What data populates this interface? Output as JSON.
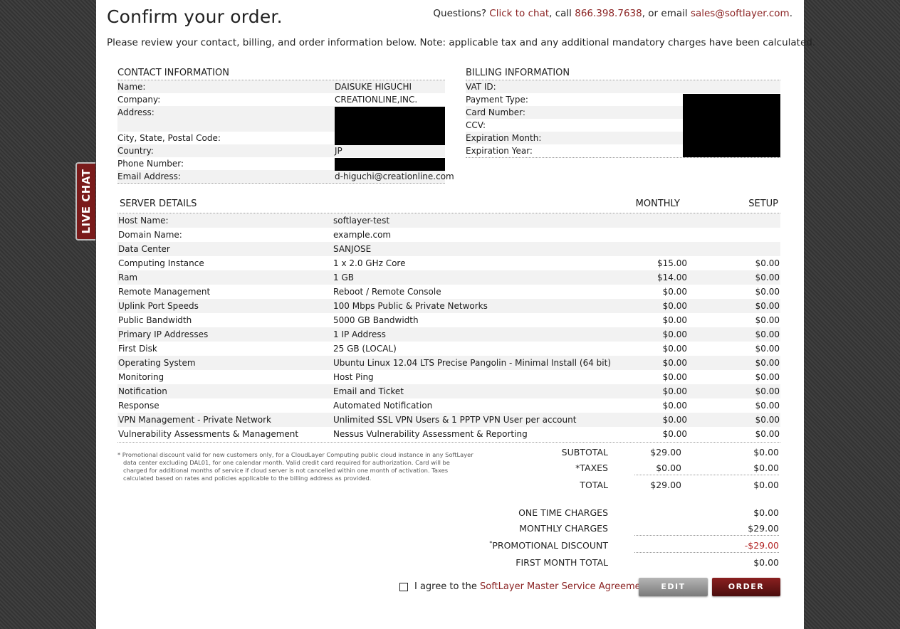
{
  "page": {
    "title": "Confirm your order.",
    "questions_prefix": "Questions?",
    "chat_link": "Click to chat",
    "call_text": ", call",
    "phone": "866.398.7638",
    "email_text": ", or email",
    "email": "sales@softlayer.com",
    "email_suffix": ".",
    "intro": "Please review your contact, billing, and order information below. Note: applicable tax and any additional mandatory charges have been calculated."
  },
  "contact": {
    "header": "CONTACT INFORMATION",
    "rows": [
      {
        "label": "Name:",
        "value": "DAISUKE HIGUCHI"
      },
      {
        "label": "Company:",
        "value": "CREATIONLINE,INC."
      },
      {
        "label": "Address:",
        "value": ""
      },
      {
        "label": "City, State, Postal Code:",
        "value": ""
      },
      {
        "label": "Country:",
        "value": "JP"
      },
      {
        "label": "Phone Number:",
        "value": ""
      },
      {
        "label": "Email Address:",
        "value": "d-higuchi@creationline.com"
      }
    ]
  },
  "billing": {
    "header": "BILLING INFORMATION",
    "rows": [
      {
        "label": "VAT ID:"
      },
      {
        "label": "Payment Type:"
      },
      {
        "label": "Card Number:"
      },
      {
        "label": "CCV:"
      },
      {
        "label": "Expiration Month:"
      },
      {
        "label": "Expiration Year:"
      }
    ]
  },
  "server": {
    "header": "SERVER DETAILS",
    "col_monthly": "MONTHLY",
    "col_setup": "SETUP",
    "rows": [
      {
        "label": "Host Name:",
        "desc": "softlayer-test",
        "monthly": "",
        "setup": ""
      },
      {
        "label": "Domain Name:",
        "desc": "example.com",
        "monthly": "",
        "setup": ""
      },
      {
        "label": "Data Center",
        "desc": "SANJOSE",
        "monthly": "",
        "setup": ""
      },
      {
        "label": "Computing Instance",
        "desc": "1 x 2.0 GHz Core",
        "monthly": "$15.00",
        "setup": "$0.00"
      },
      {
        "label": "Ram",
        "desc": "1 GB",
        "monthly": "$14.00",
        "setup": "$0.00"
      },
      {
        "label": "Remote Management",
        "desc": "Reboot / Remote Console",
        "monthly": "$0.00",
        "setup": "$0.00"
      },
      {
        "label": "Uplink Port Speeds",
        "desc": "100 Mbps Public & Private Networks",
        "monthly": "$0.00",
        "setup": "$0.00"
      },
      {
        "label": "Public Bandwidth",
        "desc": "5000 GB Bandwidth",
        "monthly": "$0.00",
        "setup": "$0.00"
      },
      {
        "label": "Primary IP Addresses",
        "desc": "1 IP Address",
        "monthly": "$0.00",
        "setup": "$0.00"
      },
      {
        "label": "First Disk",
        "desc": "25 GB (LOCAL)",
        "monthly": "$0.00",
        "setup": "$0.00"
      },
      {
        "label": "Operating System",
        "desc": "Ubuntu Linux 12.04 LTS Precise Pangolin - Minimal Install (64 bit)",
        "monthly": "$0.00",
        "setup": "$0.00"
      },
      {
        "label": "Monitoring",
        "desc": "Host Ping",
        "monthly": "$0.00",
        "setup": "$0.00"
      },
      {
        "label": "Notification",
        "desc": "Email and Ticket",
        "monthly": "$0.00",
        "setup": "$0.00"
      },
      {
        "label": "Response",
        "desc": "Automated Notification",
        "monthly": "$0.00",
        "setup": "$0.00"
      },
      {
        "label": "VPN Management - Private Network",
        "desc": "Unlimited SSL VPN Users & 1 PPTP VPN User per account",
        "monthly": "$0.00",
        "setup": "$0.00"
      },
      {
        "label": "Vulnerability Assessments & Management",
        "desc": "Nessus Vulnerability Assessment & Reporting",
        "monthly": "$0.00",
        "setup": "$0.00"
      }
    ]
  },
  "footnote": "* Promotional discount valid for new customers only, for a CloudLayer Computing public cloud instance in any SoftLayer data center excluding DAL01, for one calendar month. Valid credit card required for authorization. Card will be charged for additional months of service if cloud server is not cancelled within one month of activation. Taxes calculated based on rates and policies applicable to the billing address as provided.",
  "totals": {
    "subtotal_label": "SUBTOTAL",
    "subtotal_monthly": "$29.00",
    "subtotal_setup": "$0.00",
    "taxes_label": "*TAXES",
    "taxes_monthly": "$0.00",
    "taxes_setup": "$0.00",
    "total_label": "TOTAL",
    "total_monthly": "$29.00",
    "total_setup": "$0.00"
  },
  "charges": {
    "one_time_label": "ONE TIME CHARGES",
    "one_time": "$0.00",
    "monthly_label": "MONTHLY CHARGES",
    "monthly": "$29.00",
    "promo_star": "*",
    "promo_label": "PROMOTIONAL DISCOUNT",
    "promo": "-$29.00",
    "first_month_label": "FIRST MONTH TOTAL",
    "first_month": "$0.00"
  },
  "agreement": {
    "prefix": "I agree to the",
    "link": "SoftLayer Master Service Agreement",
    "suffix": "."
  },
  "buttons": {
    "edit": "EDIT",
    "order": "ORDER"
  },
  "live_chat": "LIVE CHAT",
  "colors": {
    "accent": "#8b2323",
    "discount": "#b22222",
    "chat_tab": "#7a1b1b"
  }
}
